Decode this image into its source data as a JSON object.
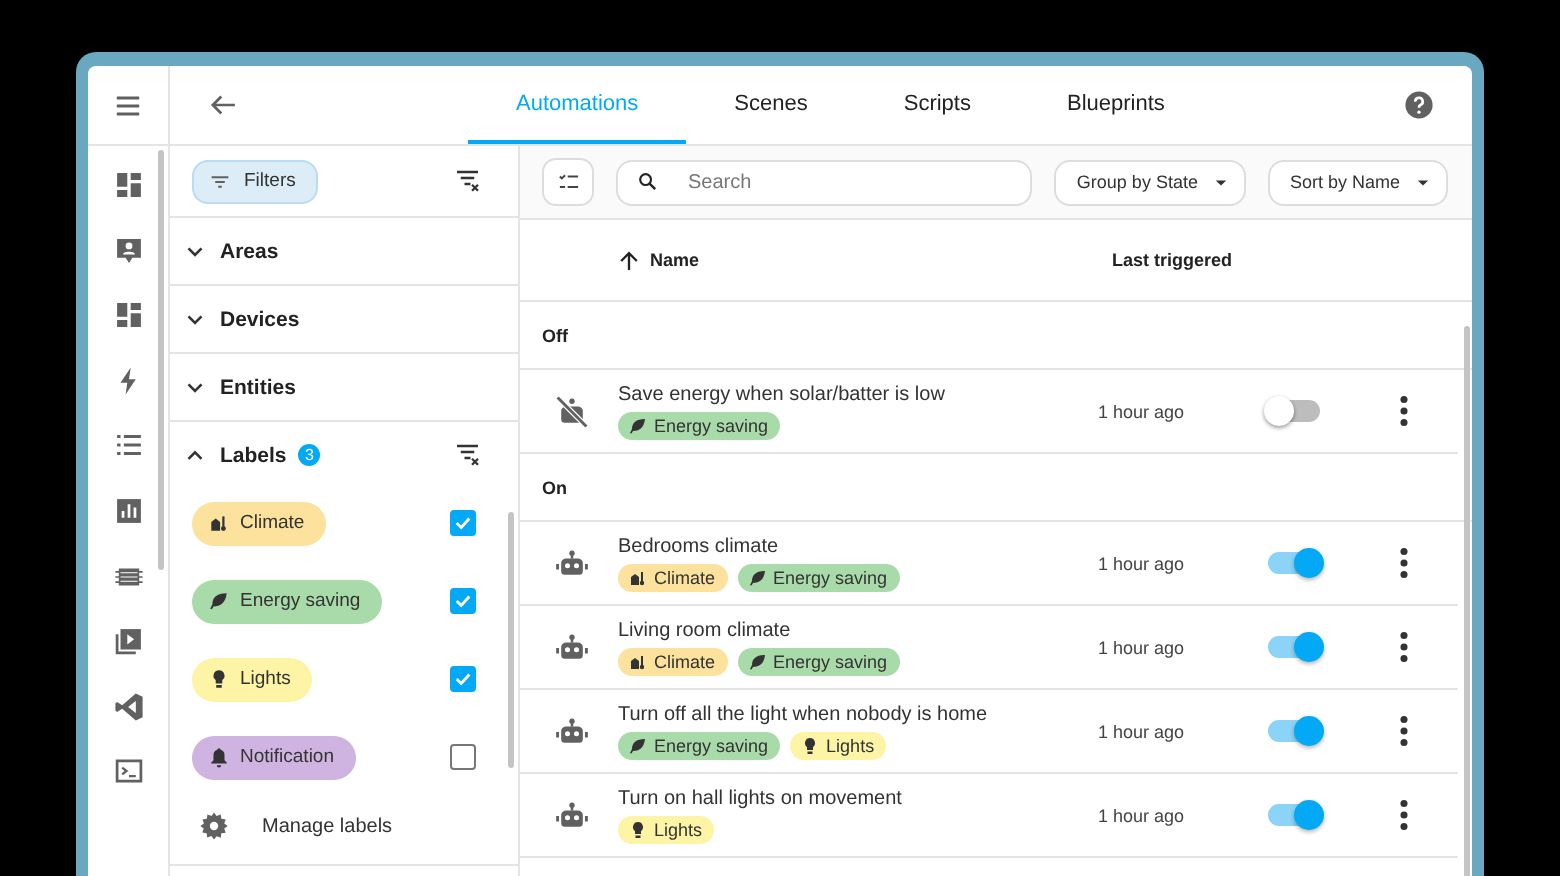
{
  "header": {
    "tabs": [
      {
        "label": "Automations",
        "selected": true
      },
      {
        "label": "Scenes",
        "selected": false
      },
      {
        "label": "Scripts",
        "selected": false
      },
      {
        "label": "Blueprints",
        "selected": false
      }
    ]
  },
  "filters": {
    "button": "Filters",
    "sections": [
      {
        "title": "Areas",
        "expanded": false
      },
      {
        "title": "Devices",
        "expanded": false
      },
      {
        "title": "Entities",
        "expanded": false
      },
      {
        "title": "Labels",
        "expanded": true,
        "badge": "3",
        "items": [
          {
            "label": "Climate",
            "kind": "climate",
            "color": "#fde29d",
            "checked": true
          },
          {
            "label": "Energy saving",
            "kind": "leaf",
            "color": "#a9dbaa",
            "checked": true
          },
          {
            "label": "Lights",
            "kind": "bulb",
            "color": "#fdf4a6",
            "checked": true
          },
          {
            "label": "Notification",
            "kind": "bell",
            "color": "#cfb4e2",
            "checked": false
          }
        ],
        "manage": "Manage labels"
      }
    ]
  },
  "toolbar": {
    "search": {
      "placeholder": "Search"
    },
    "group_by": "Group by State",
    "sort_by": "Sort by Name"
  },
  "table": {
    "columns": [
      {
        "label": "Name",
        "sorted": true
      },
      {
        "label": "Last triggered",
        "sorted": false
      }
    ],
    "groups": [
      {
        "title": "Off",
        "rows": [
          {
            "name": "Save energy when solar/batter is low",
            "labels": [
              {
                "label": "Energy saving",
                "kind": "leaf",
                "color": "#a9dbaa"
              }
            ],
            "last_triggered": "1 hour ago",
            "enabled": false
          }
        ]
      },
      {
        "title": "On",
        "rows": [
          {
            "name": "Bedrooms climate",
            "labels": [
              {
                "label": "Climate",
                "kind": "climate",
                "color": "#fde29d"
              },
              {
                "label": "Energy saving",
                "kind": "leaf",
                "color": "#a9dbaa"
              }
            ],
            "last_triggered": "1 hour ago",
            "enabled": true
          },
          {
            "name": "Living room climate",
            "labels": [
              {
                "label": "Climate",
                "kind": "climate",
                "color": "#fde29d"
              },
              {
                "label": "Energy saving",
                "kind": "leaf",
                "color": "#a9dbaa"
              }
            ],
            "last_triggered": "1 hour ago",
            "enabled": true
          },
          {
            "name": "Turn off all the light when nobody is home",
            "labels": [
              {
                "label": "Energy saving",
                "kind": "leaf",
                "color": "#a9dbaa"
              },
              {
                "label": "Lights",
                "kind": "bulb",
                "color": "#fdf4a6"
              }
            ],
            "last_triggered": "1 hour ago",
            "enabled": true
          },
          {
            "name": "Turn on hall lights on movement",
            "labels": [
              {
                "label": "Lights",
                "kind": "bulb",
                "color": "#fdf4a6"
              }
            ],
            "last_triggered": "1 hour ago",
            "enabled": true
          }
        ]
      }
    ]
  }
}
